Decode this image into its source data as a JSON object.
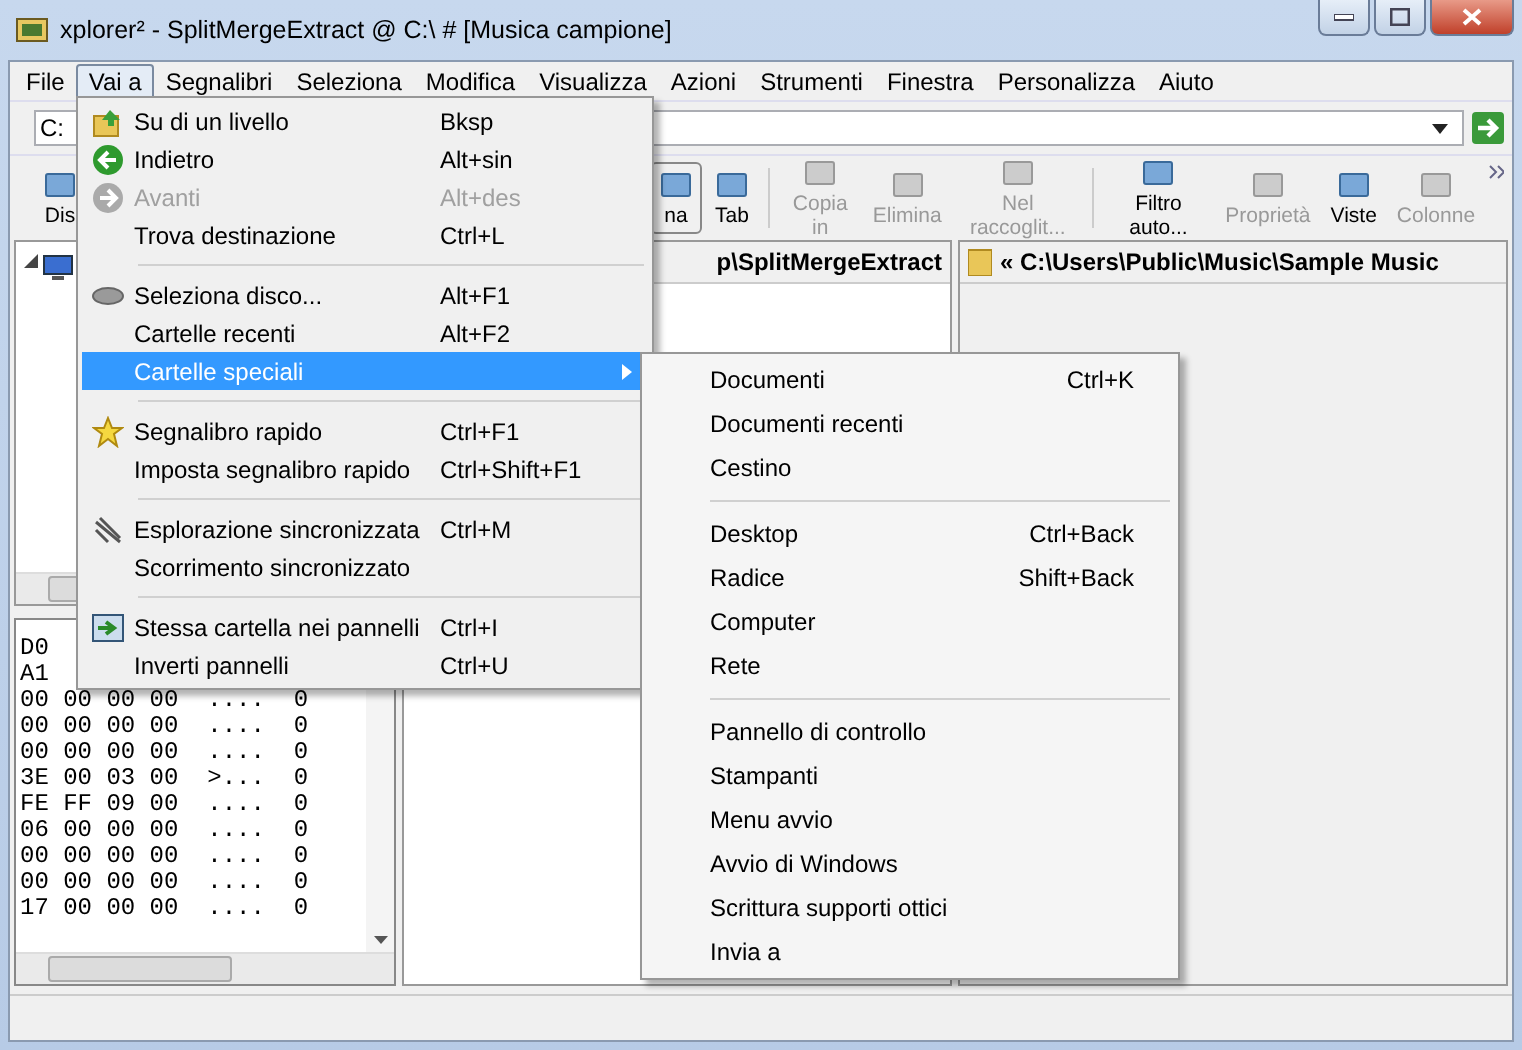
{
  "window": {
    "title": "xplorer² - SplitMergeExtract @ C:\\ # [Musica campione]"
  },
  "menu_bar": [
    {
      "label": "File",
      "selected": false
    },
    {
      "label": "Vai a",
      "selected": true
    },
    {
      "label": "Segnalibri",
      "selected": false
    },
    {
      "label": "Seleziona",
      "selected": false
    },
    {
      "label": "Modifica",
      "selected": false
    },
    {
      "label": "Visualizza",
      "selected": false
    },
    {
      "label": "Azioni",
      "selected": false
    },
    {
      "label": "Strumenti",
      "selected": false
    },
    {
      "label": "Finestra",
      "selected": false
    },
    {
      "label": "Personalizza",
      "selected": false
    },
    {
      "label": "Aiuto",
      "selected": false
    }
  ],
  "address_bar": {
    "value": "C:"
  },
  "toolbar": [
    {
      "label": "Dis",
      "disabled": false
    },
    {
      "label": "na",
      "disabled": false
    },
    {
      "label": "Tab",
      "disabled": false
    },
    {
      "label": "Copia in",
      "disabled": true
    },
    {
      "label": "Elimina",
      "disabled": true
    },
    {
      "label": "Nel raccoglit...",
      "disabled": true
    },
    {
      "label": "Filtro auto...",
      "disabled": false
    },
    {
      "label": "Proprietà",
      "disabled": true
    },
    {
      "label": "Viste",
      "disabled": false
    },
    {
      "label": "Colonne",
      "disabled": true
    }
  ],
  "hex_view": {
    "rows": [
      "D0",
      "A1",
      "00 00 00 00  ....  0",
      "00 00 00 00  ....  0",
      "00 00 00 00  ....  0",
      "3E 00 03 00  >...  0",
      "FE FF 09 00  ....  0",
      "06 00 00 00  ....  0",
      "00 00 00 00  ....  0",
      "00 00 00 00  ....  0",
      "17 00 00 00  ....  0"
    ]
  },
  "middle_pane": {
    "path": "p\\SplitMergeExtract"
  },
  "right_pane": {
    "path": "« C:\\Users\\Public\\Music\\Sample Music"
  },
  "goto_menu": [
    {
      "kind": "item",
      "label": "Su di un livello",
      "shortcut": "Bksp",
      "disabled": false,
      "selected": false
    },
    {
      "kind": "item",
      "label": "Indietro",
      "shortcut": "Alt+sin",
      "disabled": false,
      "selected": false
    },
    {
      "kind": "item",
      "label": "Avanti",
      "shortcut": "Alt+des",
      "disabled": true,
      "selected": false
    },
    {
      "kind": "item",
      "label": "Trova destinazione",
      "shortcut": "Ctrl+L",
      "disabled": false,
      "selected": false
    },
    {
      "kind": "separator"
    },
    {
      "kind": "item",
      "label": "Seleziona disco...",
      "shortcut": "Alt+F1",
      "disabled": false,
      "selected": false
    },
    {
      "kind": "item",
      "label": "Cartelle recenti",
      "shortcut": "Alt+F2",
      "disabled": false,
      "selected": false
    },
    {
      "kind": "submenu",
      "label": "Cartelle speciali",
      "disabled": false,
      "selected": true
    },
    {
      "kind": "separator"
    },
    {
      "kind": "item",
      "label": "Segnalibro rapido",
      "shortcut": "Ctrl+F1",
      "disabled": false,
      "selected": false
    },
    {
      "kind": "item",
      "label": "Imposta segnalibro rapido",
      "shortcut": "Ctrl+Shift+F1",
      "disabled": false,
      "selected": false
    },
    {
      "kind": "separator"
    },
    {
      "kind": "item",
      "label": "Esplorazione sincronizzata",
      "shortcut": "Ctrl+M",
      "disabled": false,
      "selected": false
    },
    {
      "kind": "item",
      "label": "Scorrimento sincronizzato",
      "disabled": false,
      "selected": false
    },
    {
      "kind": "separator"
    },
    {
      "kind": "item",
      "label": "Stessa cartella nei pannelli",
      "shortcut": "Ctrl+I",
      "disabled": false,
      "selected": false
    },
    {
      "kind": "item",
      "label": "Inverti pannelli",
      "shortcut": "Ctrl+U",
      "disabled": false,
      "selected": false
    }
  ],
  "special_folders_menu": [
    {
      "kind": "item",
      "label": "Documenti",
      "shortcut": "Ctrl+K"
    },
    {
      "kind": "item",
      "label": "Documenti recenti"
    },
    {
      "kind": "item",
      "label": "Cestino"
    },
    {
      "kind": "separator"
    },
    {
      "kind": "item",
      "label": "Desktop",
      "shortcut": "Ctrl+Back"
    },
    {
      "kind": "item",
      "label": "Radice",
      "shortcut": "Shift+Back"
    },
    {
      "kind": "item",
      "label": "Computer"
    },
    {
      "kind": "item",
      "label": "Rete"
    },
    {
      "kind": "separator"
    },
    {
      "kind": "item",
      "label": "Pannello di controllo"
    },
    {
      "kind": "item",
      "label": "Stampanti"
    },
    {
      "kind": "item",
      "label": "Menu avvio"
    },
    {
      "kind": "item",
      "label": "Avvio di Windows"
    },
    {
      "kind": "item",
      "label": "Scrittura supporti ottici"
    },
    {
      "kind": "item",
      "label": "Invia a"
    }
  ]
}
